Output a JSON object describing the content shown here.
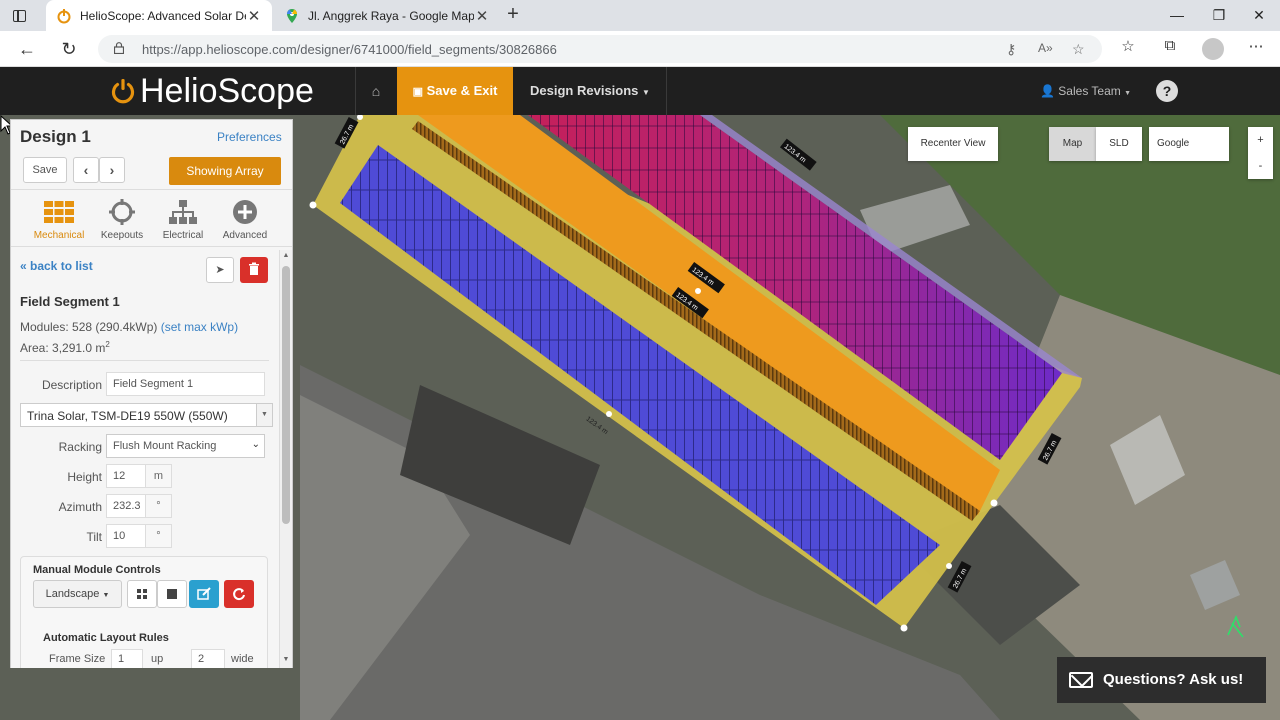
{
  "browser": {
    "tabs": [
      {
        "title": "HelioScope: Advanced Solar Des",
        "active": true
      },
      {
        "title": "Jl. Anggrek Raya - Google Maps",
        "active": false
      }
    ],
    "url": "https://app.helioscope.com/designer/6741000/field_segments/30826866"
  },
  "header": {
    "brand": "HelioScope",
    "save_exit": "Save & Exit",
    "design_revisions": "Design Revisions",
    "user": "Sales Team",
    "help": "?"
  },
  "panel": {
    "title": "Design 1",
    "preferences": "Preferences",
    "save": "Save",
    "showing_array": "Showing Array",
    "tools": [
      {
        "label": "Mechanical",
        "icon": "grid-icon",
        "active": true
      },
      {
        "label": "Keepouts",
        "icon": "keepouts-icon",
        "active": false
      },
      {
        "label": "Electrical",
        "icon": "hierarchy-icon",
        "active": false
      },
      {
        "label": "Advanced",
        "icon": "plus-circle-icon",
        "active": false
      }
    ],
    "back": "« back to list",
    "segment_title": "Field Segment 1",
    "modules_text": "Modules: 528 (290.4kWp)",
    "set_max": "(set max kWp)",
    "area_text": "Area: 3,291.0 m",
    "area_sup": "2",
    "description_label": "Description",
    "description_value": "Field Segment 1",
    "module_select": "Trina Solar, TSM-DE19 550W (550W)",
    "racking_label": "Racking",
    "racking_value": "Flush Mount Racking",
    "height_label": "Height",
    "height_value": "12",
    "height_unit": "m",
    "azimuth_label": "Azimuth",
    "azimuth_value": "232.3",
    "azimuth_unit": "°",
    "tilt_label": "Tilt",
    "tilt_value": "10",
    "tilt_unit": "°",
    "mmc_title": "Manual Module Controls",
    "landscape": "Landscape",
    "alr_title": "Automatic Layout Rules",
    "frame_label": "Frame Size",
    "frame_up_value": "1",
    "frame_up_unit": "up",
    "frame_wide_value": "2",
    "frame_wide_unit": "wide"
  },
  "map": {
    "recenter": "Recenter View",
    "map": "Map",
    "sld": "SLD",
    "google": "Google",
    "zoom_in": "+",
    "zoom_out": "-",
    "questions": "Questions? Ask us!",
    "dim_long": "123.4 m",
    "dim_short": "26.7 m"
  },
  "colors": {
    "accent": "#e6930f",
    "panel_blue": "#5a55e0",
    "roof_orange": "#ee9a1e",
    "setback_yellow": "#d8c64a",
    "danger": "#d9302a"
  }
}
